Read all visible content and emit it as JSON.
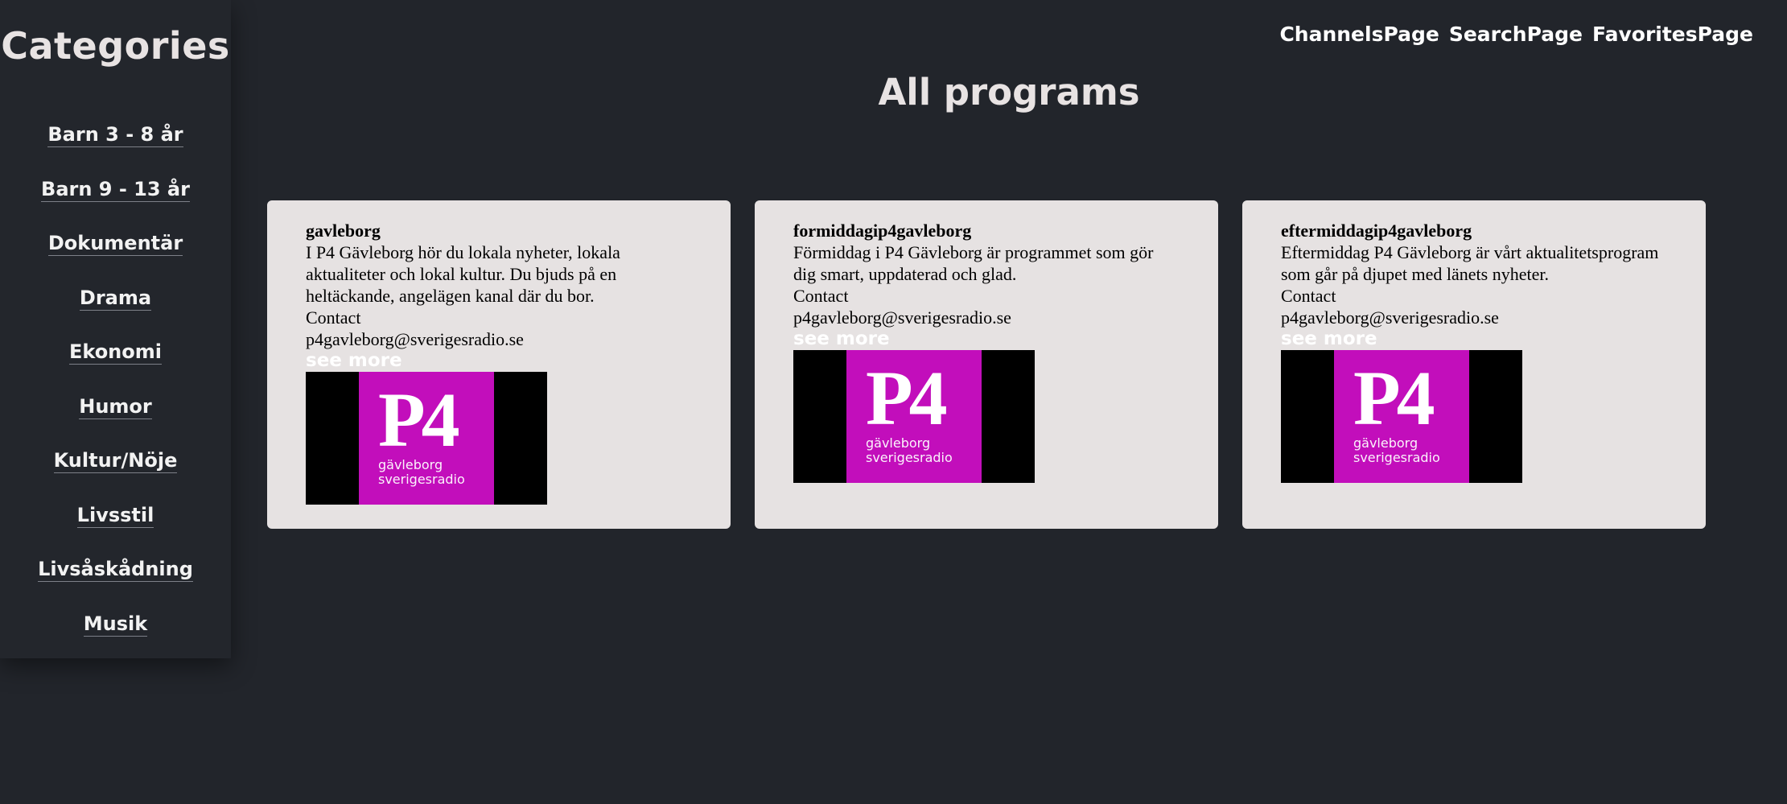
{
  "sidebar": {
    "title": "Categories",
    "items": [
      {
        "label": "Barn 3 - 8 år"
      },
      {
        "label": "Barn 9 - 13 år"
      },
      {
        "label": "Dokumentär"
      },
      {
        "label": "Drama"
      },
      {
        "label": "Ekonomi"
      },
      {
        "label": "Humor"
      },
      {
        "label": "Kultur/Nöje"
      },
      {
        "label": "Livsstil"
      },
      {
        "label": "Livsåskådning"
      },
      {
        "label": "Musik"
      }
    ]
  },
  "nav": {
    "channels": "ChannelsPage",
    "search": "SearchPage",
    "favorites": "FavoritesPage"
  },
  "main": {
    "title": "All programs",
    "programs": [
      {
        "name": "gavleborg",
        "description": "I P4 Gävleborg hör du lokala nyheter, lokala aktualiteter och lokal kultur. Du bjuds på en heltäckande, angelägen kanal där du bor.",
        "contact_label": "Contact",
        "email": "p4gavleborg@sverigesradio.se",
        "see_more": "see more",
        "logo": {
          "mark": "P4",
          "region": "gävleborg",
          "brand": "sverigesradio"
        }
      },
      {
        "name": "formiddagip4gavleborg",
        "description": "Förmiddag i P4 Gävleborg är programmet som gör dig smart, uppdaterad och glad.",
        "contact_label": "Contact",
        "email": "p4gavleborg@sverigesradio.se",
        "see_more": "see more",
        "logo": {
          "mark": "P4",
          "region": "gävleborg",
          "brand": "sverigesradio"
        }
      },
      {
        "name": "eftermiddagip4gavleborg",
        "description": "Eftermiddag P4 Gävleborg är vårt aktualitetsprogram som går på djupet med länets nyheter.",
        "contact_label": "Contact",
        "email": "p4gavleborg@sverigesradio.se",
        "see_more": "see more",
        "logo": {
          "mark": "P4",
          "region": "gävleborg",
          "brand": "sverigesradio"
        }
      }
    ]
  },
  "colors": {
    "background": "#22252b",
    "card": "#e6e2e2",
    "logo_magenta": "#c20ebb"
  }
}
